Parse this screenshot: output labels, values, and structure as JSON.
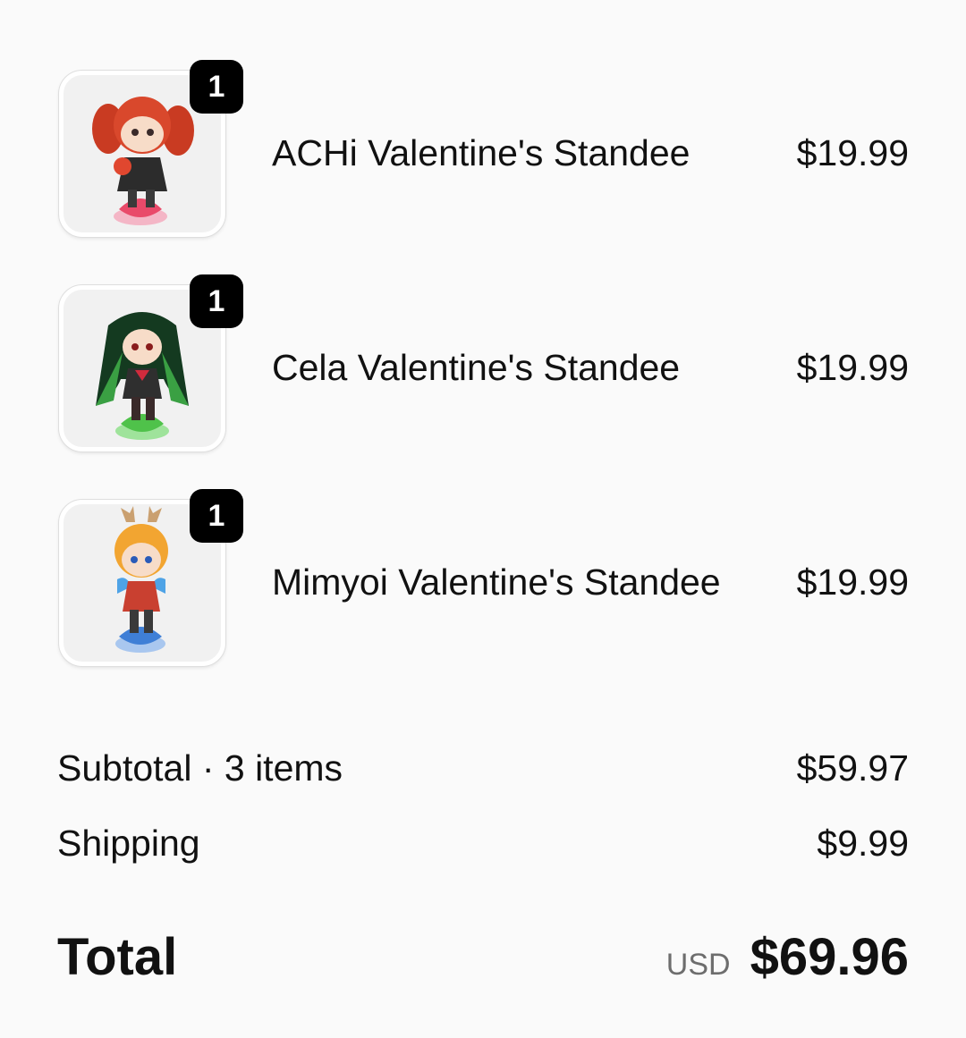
{
  "items": [
    {
      "title": "ACHi Valentine's Standee",
      "price": "$19.99",
      "quantity": "1",
      "image": "standee-achi-image"
    },
    {
      "title": "Cela Valentine's Standee",
      "price": "$19.99",
      "quantity": "1",
      "image": "standee-cela-image"
    },
    {
      "title": "Mimyoi Valentine's Standee",
      "price": "$19.99",
      "quantity": "1",
      "image": "standee-mimyoi-image"
    }
  ],
  "summary": {
    "subtotal_label": "Subtotal · 3 items",
    "subtotal_value": "$59.97",
    "shipping_label": "Shipping",
    "shipping_value": "$9.99",
    "total_label": "Total",
    "currency": "USD",
    "total_value": "$69.96"
  },
  "colors": {
    "background": "#fafafa",
    "text": "#111111",
    "badge": "#000000",
    "muted": "#6d6d6d",
    "achi_accent": "#d9482c",
    "cela_accent": "#2e8b3a",
    "mimyoi_accent": "#f2a531"
  }
}
